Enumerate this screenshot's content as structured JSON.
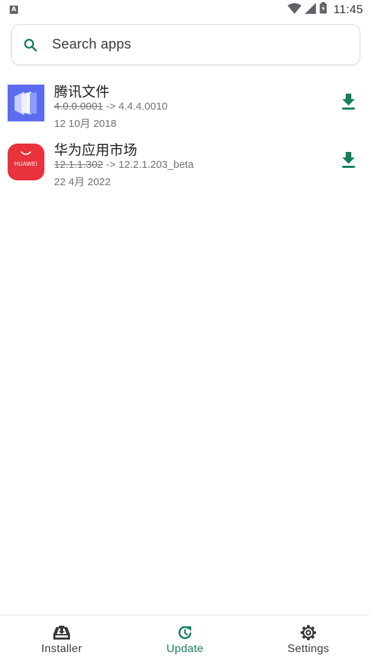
{
  "status_bar": {
    "time": "11:45",
    "notification_icon_letter": "A",
    "icons": [
      "wifi-icon",
      "signal-icon",
      "battery-icon"
    ]
  },
  "search": {
    "placeholder": "Search apps",
    "icon": "search-icon"
  },
  "apps": [
    {
      "name": "腾讯文件",
      "old_version": "4.0.0.0001",
      "arrow": " -> ",
      "new_version": "4.4.4.0010",
      "date": "12 10月 2018",
      "icon": "tencent-files-icon"
    },
    {
      "name": "华为应用市场",
      "old_version": "12.1.1.302",
      "arrow": " -> ",
      "new_version": "12.2.1.203_beta",
      "date": "22 4月 2022",
      "icon": "huawei-appgallery-icon",
      "icon_text": "HUAWEI"
    }
  ],
  "bottom_nav": [
    {
      "label": "Installer",
      "icon": "installer-icon",
      "active": false
    },
    {
      "label": "Update",
      "icon": "update-icon",
      "active": true
    },
    {
      "label": "Settings",
      "icon": "gear-icon",
      "active": false
    }
  ],
  "colors": {
    "accent": "#127f5e",
    "huawei_red": "#e8323c",
    "tencent_blue": "#5c6ef0"
  }
}
